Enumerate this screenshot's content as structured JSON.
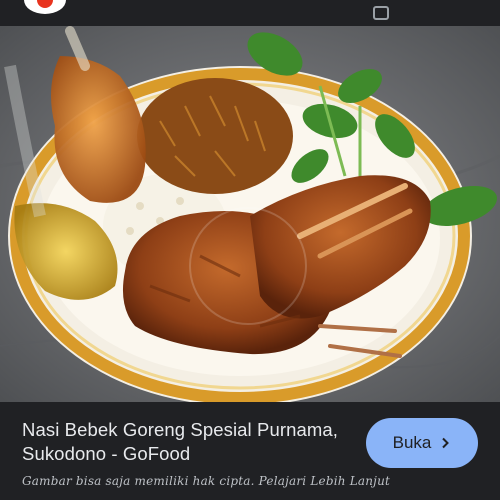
{
  "header": {
    "logo_icon": "app-logo-icon",
    "action_icon": "card-icon"
  },
  "image": {
    "alt_icon": "photo-icon"
  },
  "result": {
    "title": "Nasi Bebek Goreng Spesial Purnama, Sukodono - GoFood",
    "open_label": "Buka",
    "copyright_note": "Gambar bisa saja memiliki hak cipta. Pelajari Lebih Lanjut"
  },
  "colors": {
    "background": "#202124",
    "button": "#8ab4f8",
    "text": "#e8eaed"
  }
}
